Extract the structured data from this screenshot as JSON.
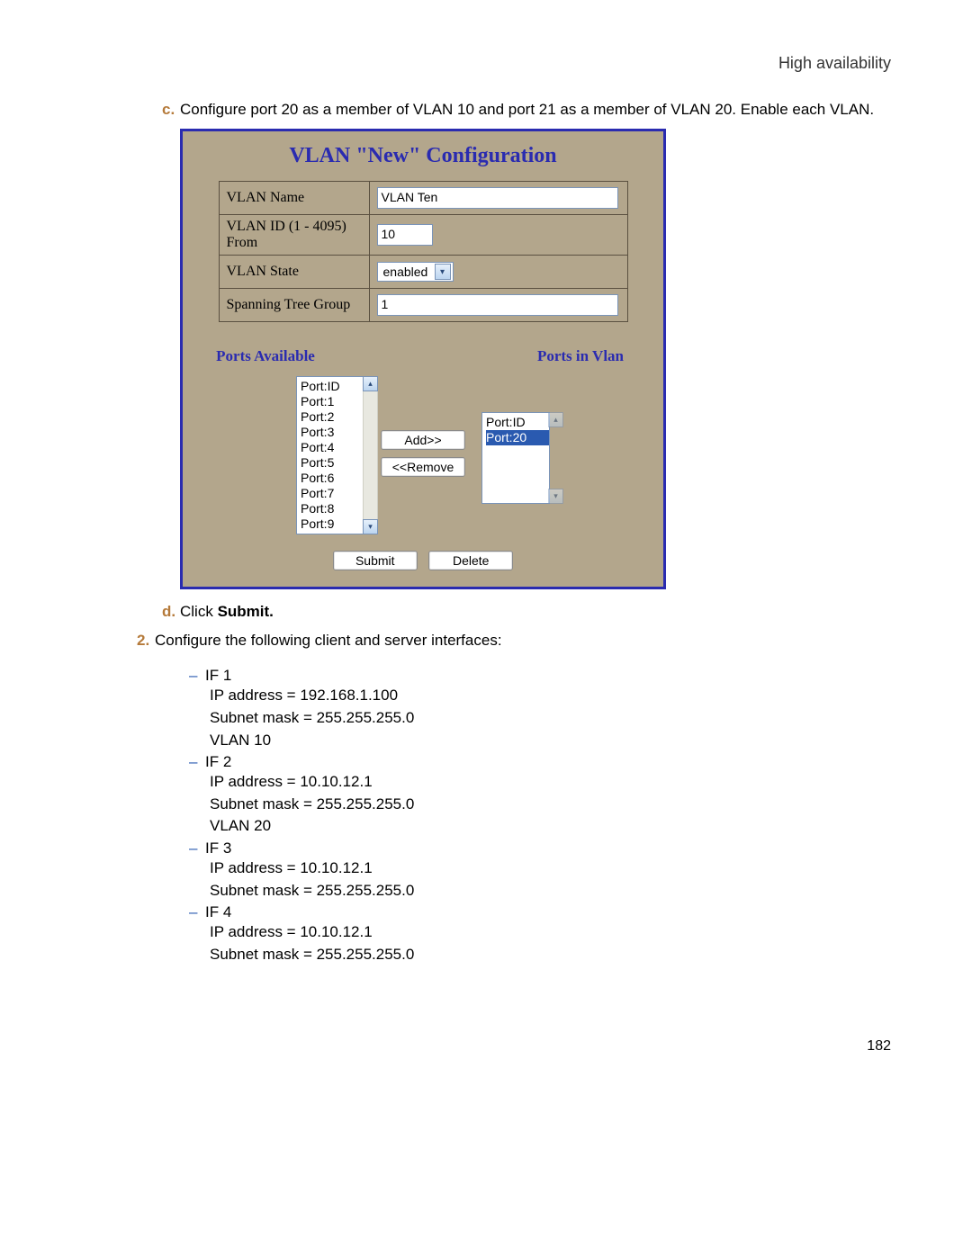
{
  "header": {
    "section_title": "High availability"
  },
  "step_c": {
    "letter": "c.",
    "text": "Configure port 20 as a member of VLAN 10 and port 21 as a member of VLAN 20. Enable each VLAN."
  },
  "screenshot": {
    "title": "VLAN \"New\" Configuration",
    "form": {
      "vlan_name_label": "VLAN Name",
      "vlan_name_value": "VLAN Ten",
      "vlan_id_label": "VLAN ID (1 - 4095) From",
      "vlan_id_value": "10",
      "vlan_state_label": "VLAN State",
      "vlan_state_value": "enabled",
      "stp_label": "Spanning Tree Group",
      "stp_value": "1"
    },
    "ports_available_heading": "Ports Available",
    "ports_in_vlan_heading": "Ports in Vlan",
    "ports_available": [
      "Port:ID",
      "Port:1",
      "Port:2",
      "Port:3",
      "Port:4",
      "Port:5",
      "Port:6",
      "Port:7",
      "Port:8",
      "Port:9"
    ],
    "ports_in_vlan": [
      "Port:ID",
      "Port:20"
    ],
    "btn_add": "Add>>",
    "btn_remove": "<<Remove",
    "btn_submit": "Submit",
    "btn_delete": "Delete"
  },
  "step_d": {
    "letter": "d.",
    "prefix": "Click ",
    "bold": "Submit."
  },
  "step_2": {
    "number": "2.",
    "text": "Configure the following client and server interfaces:"
  },
  "interfaces": [
    {
      "name": "IF 1",
      "lines": [
        "IP address = 192.168.1.100",
        "Subnet mask = 255.255.255.0",
        "VLAN 10"
      ]
    },
    {
      "name": "IF 2",
      "lines": [
        "IP address = 10.10.12.1",
        "Subnet mask = 255.255.255.0",
        "VLAN 20"
      ]
    },
    {
      "name": "IF 3",
      "lines": [
        "IP address = 10.10.12.1",
        "Subnet mask = 255.255.255.0"
      ]
    },
    {
      "name": "IF 4",
      "lines": [
        "IP address = 10.10.12.1",
        "Subnet mask = 255.255.255.0"
      ]
    }
  ],
  "page_number": "182"
}
